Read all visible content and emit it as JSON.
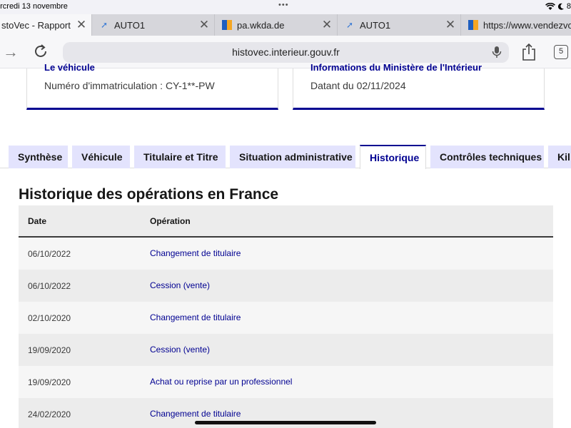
{
  "statusbar": {
    "time": "ercredi 13 novembre",
    "dots": "•••",
    "battery": "8"
  },
  "browser_tabs": [
    {
      "title": "stoVec - Rapport ve",
      "icon": "histovec-icon",
      "active": true
    },
    {
      "title": "AUTO1",
      "icon": "auto1-icon",
      "active": false
    },
    {
      "title": "pa.wkda.de",
      "icon": "flag-icon",
      "active": false
    },
    {
      "title": "AUTO1",
      "icon": "auto1-icon",
      "active": false
    },
    {
      "title": "https://www.vendezvo",
      "icon": "flag-icon",
      "active": false
    }
  ],
  "toolbar": {
    "url": "histovec.interieur.gouv.fr",
    "tabs_count": "5"
  },
  "cards": [
    {
      "heading": "Le véhicule",
      "text": "Numéro d'immatriculation : CY-1**-PW"
    },
    {
      "heading": "Informations du Ministère de l'Intérieur",
      "text": "Datant du 02/11/2024"
    }
  ],
  "section_tabs": [
    {
      "label": "Synthèse",
      "active": false
    },
    {
      "label": "Véhicule",
      "active": false
    },
    {
      "label": "Titulaire et Titre",
      "active": false
    },
    {
      "label": "Situation administrative",
      "active": false
    },
    {
      "label": "Historique",
      "active": true
    },
    {
      "label": "Contrôles techniques",
      "active": false
    },
    {
      "label": "Kil",
      "active": false
    }
  ],
  "main": {
    "title": "Historique des opérations en France",
    "table": {
      "headers": {
        "date": "Date",
        "operation": "Opération"
      },
      "rows": [
        {
          "date": "06/10/2022",
          "operation": "Changement de titulaire"
        },
        {
          "date": "06/10/2022",
          "operation": "Cession (vente)"
        },
        {
          "date": "02/10/2020",
          "operation": "Changement de titulaire"
        },
        {
          "date": "19/09/2020",
          "operation": "Cession (vente)"
        },
        {
          "date": "19/09/2020",
          "operation": "Achat ou reprise par un professionnel"
        },
        {
          "date": "24/02/2020",
          "operation": "Changement de titulaire"
        }
      ]
    }
  },
  "colors": {
    "accent": "#000091",
    "tab_bg": "#e3e3fd",
    "row_light": "#f6f6f6",
    "row_dark": "#ececec"
  }
}
